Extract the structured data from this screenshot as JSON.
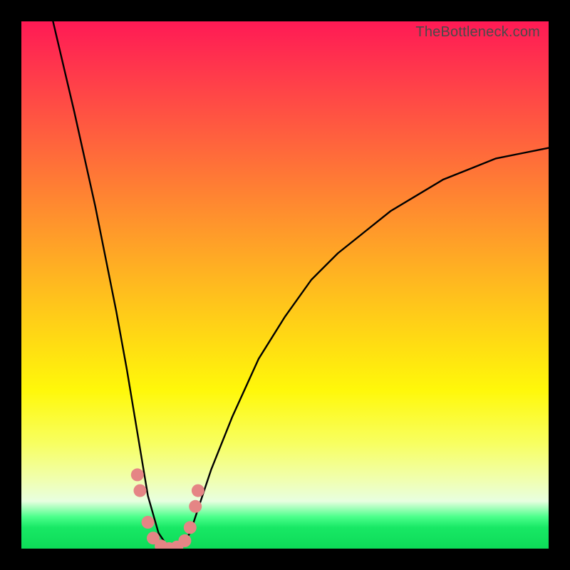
{
  "watermark": "TheBottleneck.com",
  "chart_data": {
    "type": "line",
    "title": "",
    "xlabel": "",
    "ylabel": "",
    "xlim": [
      0,
      100
    ],
    "ylim": [
      0,
      100
    ],
    "note": "V-shaped bottleneck curve on gradient background; y-axis roughly represents bottleneck percentage (100 at top, 0 at bottom), x-axis the component score. Minimum lies near x≈28 at y≈0. Values estimated from pixel positions.",
    "series": [
      {
        "name": "bottleneck-curve",
        "x": [
          6,
          10,
          14,
          18,
          20,
          22,
          24,
          26,
          28,
          30,
          32,
          34,
          36,
          40,
          45,
          50,
          55,
          60,
          65,
          70,
          75,
          80,
          85,
          90,
          95,
          100
        ],
        "y": [
          100,
          83,
          65,
          45,
          34,
          22,
          10,
          3,
          0,
          0,
          3,
          9,
          15,
          25,
          36,
          44,
          51,
          56,
          60,
          64,
          67,
          70,
          72,
          74,
          75,
          76
        ]
      }
    ],
    "markers": {
      "name": "highlight-dots",
      "color": "#e58585",
      "points": [
        {
          "x": 22.0,
          "y": 14
        },
        {
          "x": 22.5,
          "y": 11
        },
        {
          "x": 24.0,
          "y": 5
        },
        {
          "x": 25.0,
          "y": 2
        },
        {
          "x": 26.5,
          "y": 0.5
        },
        {
          "x": 28.0,
          "y": 0
        },
        {
          "x": 29.5,
          "y": 0.3
        },
        {
          "x": 31.0,
          "y": 1.5
        },
        {
          "x": 32.0,
          "y": 4
        },
        {
          "x": 33.0,
          "y": 8
        },
        {
          "x": 33.5,
          "y": 11
        }
      ]
    },
    "gradient_stops": [
      {
        "pos": 0,
        "color": "#ff1a55"
      },
      {
        "pos": 50,
        "color": "#ffba1f"
      },
      {
        "pos": 75,
        "color": "#fff80a"
      },
      {
        "pos": 95,
        "color": "#18e865"
      },
      {
        "pos": 100,
        "color": "#0ddb58"
      }
    ]
  }
}
